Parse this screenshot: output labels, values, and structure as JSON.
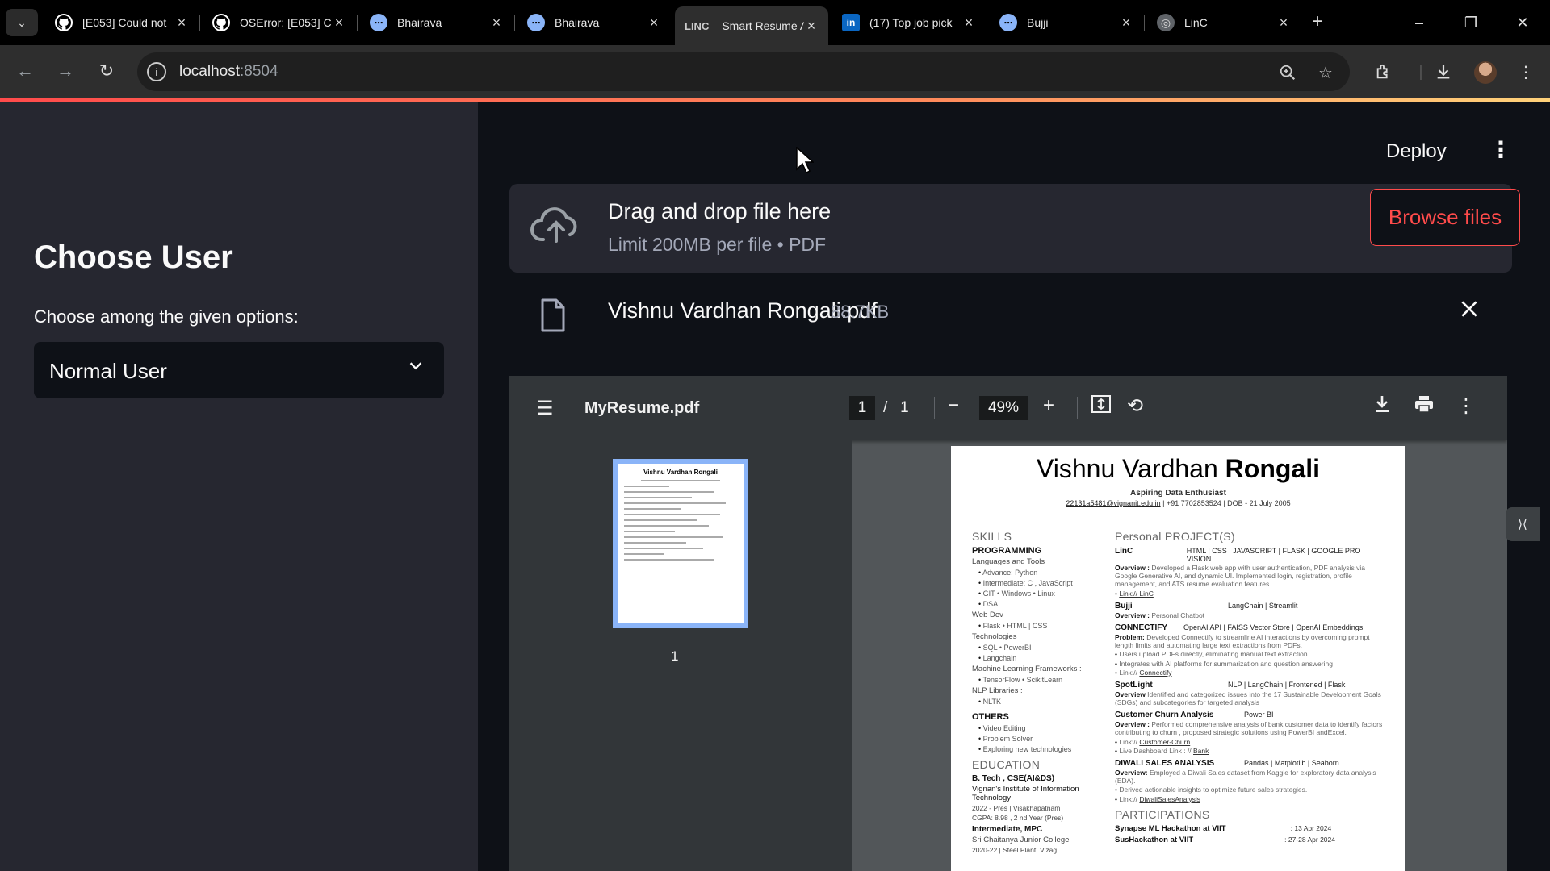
{
  "browser": {
    "tabs": [
      {
        "title": "[E053] Could not",
        "icon": "github-icon",
        "color": "#ffffff",
        "active": false
      },
      {
        "title": "OSError: [E053] C",
        "icon": "github-icon",
        "color": "#ffffff",
        "active": false
      },
      {
        "title": "Bhairava",
        "icon": "chat-bubble-icon",
        "color": "#8ab4f8",
        "active": false
      },
      {
        "title": "Bhairava",
        "icon": "chat-bubble-icon",
        "color": "#8ab4f8",
        "active": false
      },
      {
        "title": "Smart Resume A",
        "icon": "linc-icon",
        "color": "#cccccc",
        "active": true
      },
      {
        "title": "(17) Top job pick",
        "icon": "linkedin-icon",
        "color": "#0a66c2",
        "active": false
      },
      {
        "title": "Bujji",
        "icon": "chat-bubble-icon",
        "color": "#8ab4f8",
        "active": false
      },
      {
        "title": "LinC",
        "icon": "globe-icon",
        "color": "#9aa0a6",
        "active": false
      }
    ],
    "fav_labels": {
      "linc": "LINC",
      "linkedin": "in"
    },
    "url_host": "localhost",
    "url_port": ":8504"
  },
  "sidebar": {
    "title": "Choose User",
    "select_label": "Choose among the given options:",
    "selected_option": "Normal User"
  },
  "header": {
    "deploy_label": "Deploy"
  },
  "uploader": {
    "title": "Drag and drop file here",
    "subtitle": "Limit 200MB per file • PDF",
    "browse_label": "Browse files",
    "file_name": "Vishnu Vardhan Rongali.pdf",
    "file_size": "88.7KB"
  },
  "pdf_viewer": {
    "doc_name": "MyResume.pdf",
    "current_page": "1",
    "page_separator": "/",
    "total_pages": "1",
    "zoom": "49%",
    "thumb_label": "1"
  },
  "resume": {
    "first_name": "Vishnu Vardhan ",
    "last_name": "Rongali",
    "tagline": "Aspiring Data Enthusiast",
    "email": "22131a5481@vignanit.edu.in",
    "contact_rest": " | +91 7702853524 | DOB - 21 July 2005",
    "skills_heading": "SKILLS",
    "programming_heading": "PROGRAMMING",
    "languages_label": "Languages and Tools",
    "languages": [
      "Advance: Python",
      "Intermediate: C , JavaScript",
      "GIT • Windows • Linux",
      "DSA"
    ],
    "webdev_label": "Web Dev",
    "webdev": [
      "Flask • HTML | CSS"
    ],
    "tech_label": "Technologies",
    "tech": [
      "SQL • PowerBI",
      "Langchain"
    ],
    "ml_label": "Machine Learning Frameworks :",
    "ml": [
      "TensorFlow • ScikitLearn"
    ],
    "nlp_label": "NLP Libraries :",
    "nlp": [
      "NLTK"
    ],
    "others_heading": "OTHERS",
    "others": [
      "Video Editing",
      "Problem Solver",
      "Exploring new technologies"
    ],
    "education_heading": "EDUCATION",
    "edu_degree": "B. Tech ,   CSE(AI&DS)",
    "edu_inst": "Vignan's Institute of Information Technology",
    "edu_years": "2022 - Pres | Visakhapatnam",
    "edu_cgpa": "CGPA: 8.98 , 2 nd Year (Pres)",
    "edu_inter": "Intermediate, MPC",
    "edu_college": "Sri Chaitanya Junior College",
    "edu_college_years": "2020-22 | Steel Plant, Vizag",
    "projects_heading": "Personal PROJECT(S)",
    "proj1_name": "LinC",
    "proj1_tech": "HTML | CSS | JAVASCRIPT | FLASK | GOOGLE PRO VISION",
    "proj1_label": "Overview :",
    "proj1_text": " Developed a Flask web app with user authentication, PDF analysis via Google Generative AI, and dynamic UI. Implemented login, registration, profile management, and ATS resume evaluation features.",
    "proj1_link": "Link:// LinC",
    "proj2_name": "Bujji",
    "proj2_tech": "LangChain | Streamlit",
    "proj2_label": "Overview :",
    "proj2_text": " Personal Chatbot",
    "proj3_name": "CONNECTIFY",
    "proj3_tech": "OpenAI API | FAISS Vector Store | OpenAI Embeddings",
    "proj3_label": "Problem:",
    "proj3_text": " Developed Connectify to streamline AI interactions by overcoming prompt length limits and automating large text extractions from PDFs.",
    "proj3_b1": "Users upload PDFs directly, eliminating manual text extraction.",
    "proj3_b2": "Integrates with AI platforms for summarization and question answering",
    "proj3_link_prefix": "Link:// ",
    "proj3_link": "Connectify",
    "proj4_name": "SpotLight",
    "proj4_tech": "NLP | LangChain | Frontened | Flask",
    "proj4_label": "Overview",
    "proj4_text": " Identified and categorized issues into the 17 Sustainable Development Goals (SDGs) and subcategories for targeted analysis",
    "proj5_name": "Customer Churn Analysis",
    "proj5_tech": "Power BI",
    "proj5_label": "Overview :",
    "proj5_text": " Performed comprehensive analysis of bank customer data to identify factors contributing to churn , proposed strategic solutions using PowerBI andExcel.",
    "proj5_link_prefix": "Link:// ",
    "proj5_link": "Customer-Churn",
    "proj5_live_prefix": "Live  Dashboard Link : // ",
    "proj5_live": "Bank",
    "proj6_name": "DIWALI SALES ANALYSIS",
    "proj6_tech": "Pandas | Matplotlib | Seaborn",
    "proj6_label": "Overview:",
    "proj6_text": " Employed a Diwali Sales dataset from Kaggle for exploratory data analysis (EDA).",
    "proj6_b1": "Derived actionable insights to optimize future sales strategies.",
    "proj6_link_prefix": "Link:// ",
    "proj6_link": "DiwaliSalesAnalysis",
    "participations_heading": "PARTICIPATIONS",
    "part1_name": "Synapse ML Hackathon  at VIIT",
    "part1_date": ": 13 Apr 2024",
    "part2_name": "SusHackathon  at VIIT",
    "part2_date": ": 27-28 Apr 2024"
  },
  "thumbnail": {
    "title": "Vishnu Vardhan Rongali"
  }
}
